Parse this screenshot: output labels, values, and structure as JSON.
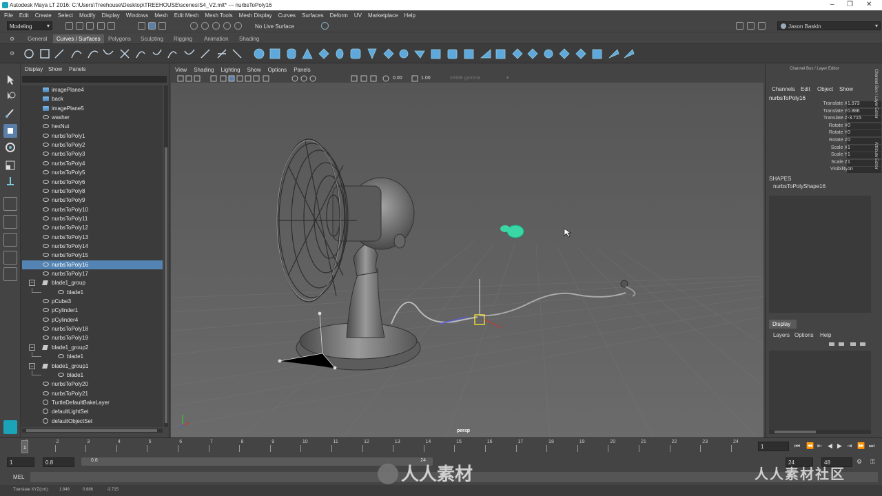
{
  "title_bar": {
    "text": "Autodesk Maya LT 2016: C:\\Users\\Treehouse\\Desktop\\TREEHOUSE\\scenes\\S4_V2.mlt*  ---  nurbsToPoly16"
  },
  "menu": [
    "File",
    "Edit",
    "Create",
    "Select",
    "Modify",
    "Display",
    "Windows",
    "Mesh",
    "Edit Mesh",
    "Mesh Tools",
    "Mesh Display",
    "Curves",
    "Surfaces",
    "Deform",
    "UV",
    "Marketplace",
    "Help"
  ],
  "status": {
    "mode": "Modeling",
    "live_surface": "No Live Surface",
    "user": "Jason Baskin"
  },
  "shelf_tabs": [
    "General",
    "Curves / Surfaces",
    "Polygons",
    "Sculpting",
    "Rigging",
    "Animation",
    "Shading"
  ],
  "shelf_active_tab": "Curves / Surfaces",
  "outliner": {
    "menu": [
      "Display",
      "Show",
      "Panels"
    ],
    "items": [
      {
        "label": "imagePlane4",
        "type": "img",
        "indent": 1
      },
      {
        "label": "back",
        "type": "img",
        "indent": 1
      },
      {
        "label": "imagePlane5",
        "type": "img",
        "indent": 1
      },
      {
        "label": "washer",
        "type": "mesh",
        "indent": 1
      },
      {
        "label": "hexNut",
        "type": "mesh",
        "indent": 1
      },
      {
        "label": "nurbsToPoly1",
        "type": "mesh",
        "indent": 1
      },
      {
        "label": "nurbsToPoly2",
        "type": "mesh",
        "indent": 1
      },
      {
        "label": "nurbsToPoly3",
        "type": "mesh",
        "indent": 1
      },
      {
        "label": "nurbsToPoly4",
        "type": "mesh",
        "indent": 1
      },
      {
        "label": "nurbsToPoly5",
        "type": "mesh",
        "indent": 1
      },
      {
        "label": "nurbsToPoly6",
        "type": "mesh",
        "indent": 1
      },
      {
        "label": "nurbsToPoly8",
        "type": "mesh",
        "indent": 1
      },
      {
        "label": "nurbsToPoly9",
        "type": "mesh",
        "indent": 1
      },
      {
        "label": "nurbsToPoly10",
        "type": "mesh",
        "indent": 1
      },
      {
        "label": "nurbsToPoly11",
        "type": "mesh",
        "indent": 1
      },
      {
        "label": "nurbsToPoly12",
        "type": "mesh",
        "indent": 1
      },
      {
        "label": "nurbsToPoly13",
        "type": "mesh",
        "indent": 1
      },
      {
        "label": "nurbsToPoly14",
        "type": "mesh",
        "indent": 1
      },
      {
        "label": "nurbsToPoly15",
        "type": "mesh",
        "indent": 1
      },
      {
        "label": "nurbsToPoly16",
        "type": "mesh",
        "indent": 1,
        "selected": true
      },
      {
        "label": "nurbsToPoly17",
        "type": "mesh",
        "indent": 1
      },
      {
        "label": "blade1_group",
        "type": "grp",
        "indent": 1,
        "expander": "−"
      },
      {
        "label": "blade1",
        "type": "mesh",
        "indent": 2
      },
      {
        "label": "pCube3",
        "type": "mesh",
        "indent": 1
      },
      {
        "label": "pCylinder1",
        "type": "mesh",
        "indent": 1
      },
      {
        "label": "pCylinder4",
        "type": "mesh",
        "indent": 1
      },
      {
        "label": "nurbsToPoly18",
        "type": "mesh",
        "indent": 1
      },
      {
        "label": "nurbsToPoly19",
        "type": "mesh",
        "indent": 1
      },
      {
        "label": "blade1_group2",
        "type": "grp",
        "indent": 1,
        "expander": "−"
      },
      {
        "label": "blade1",
        "type": "mesh",
        "indent": 2
      },
      {
        "label": "blade1_group1",
        "type": "grp",
        "indent": 1,
        "expander": "−"
      },
      {
        "label": "blade1",
        "type": "mesh",
        "indent": 2
      },
      {
        "label": "nurbsToPoly20",
        "type": "mesh",
        "indent": 1
      },
      {
        "label": "nurbsToPoly21",
        "type": "mesh",
        "indent": 1
      },
      {
        "label": "TurtleDefaultBakeLayer",
        "type": "set",
        "indent": 1
      },
      {
        "label": "defaultLightSet",
        "type": "set",
        "indent": 1
      },
      {
        "label": "defaultObjectSet",
        "type": "set",
        "indent": 1
      }
    ]
  },
  "viewport": {
    "menu": [
      "View",
      "Shading",
      "Lighting",
      "Show",
      "Options",
      "Panels"
    ],
    "exposure": "0.00",
    "gamma": "1.00",
    "color_space": "sRGB gamma",
    "camera_label": "persp"
  },
  "channel_box": {
    "header": "Channel Box / Layer Editor",
    "menu": [
      "Channels",
      "Edit",
      "Object",
      "Show"
    ],
    "object": "nurbsToPoly16",
    "attributes": [
      {
        "name": "Translate X",
        "value": "1.973"
      },
      {
        "name": "Translate Y",
        "value": "0.886"
      },
      {
        "name": "Translate Z",
        "value": "-3.715"
      },
      {
        "name": "Rotate X",
        "value": "0"
      },
      {
        "name": "Rotate Y",
        "value": "0"
      },
      {
        "name": "Rotate Z",
        "value": "0"
      },
      {
        "name": "Scale X",
        "value": "1"
      },
      {
        "name": "Scale Y",
        "value": "1"
      },
      {
        "name": "Scale Z",
        "value": "1"
      },
      {
        "name": "Visibility",
        "value": "on"
      }
    ],
    "shapes_heading": "SHAPES",
    "shape": "nurbsToPolyShape16",
    "display_tab": "Display",
    "layer_menu": [
      "Layers",
      "Options",
      "Help"
    ],
    "side_tabs": [
      "Channel Box / Layer Editor",
      "Attribute Editor"
    ]
  },
  "timeline": {
    "ticks": [
      "1",
      "2",
      "3",
      "4",
      "5",
      "6",
      "7",
      "8",
      "9",
      "10",
      "11",
      "12",
      "13",
      "14",
      "15",
      "16",
      "17",
      "18",
      "19",
      "20",
      "21",
      "22",
      "23",
      "24"
    ],
    "current_frame": "1",
    "end_display": "1"
  },
  "range": {
    "start": "1",
    "anim_start": "0.8",
    "range_start": "0.8",
    "range_end": "24",
    "end": "24",
    "anim_end": "48"
  },
  "command": {
    "lang": "MEL"
  },
  "help_line": {
    "label": "Translate XYZ(cm):",
    "x": "1.846",
    "y": "0.886",
    "z": "-3.715"
  },
  "watermarks": {
    "center": "人人素材",
    "right": "人人素材社区"
  }
}
